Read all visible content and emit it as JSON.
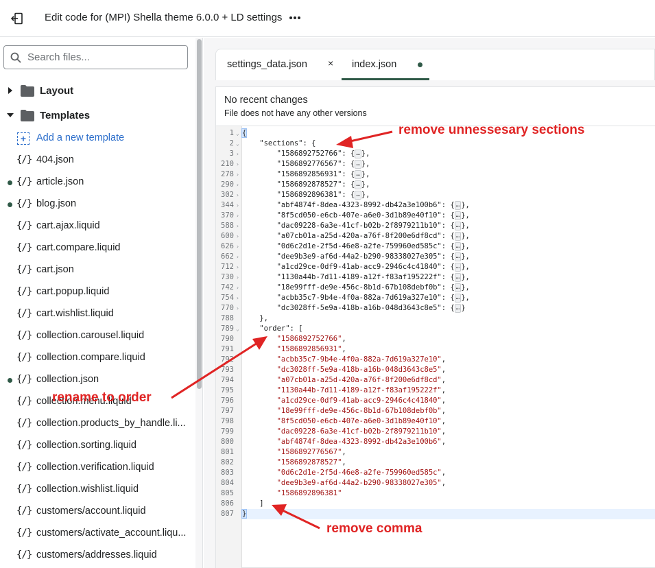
{
  "header": {
    "title": "Edit code for (MPI) Shella theme 6.0.0 + LD settings",
    "back_icon": "exit-icon",
    "more_icon": "ellipsis-icon"
  },
  "sidebar": {
    "search_placeholder": "Search files...",
    "folders": [
      {
        "label": "Layout",
        "expanded": false
      },
      {
        "label": "Templates",
        "expanded": true
      }
    ],
    "add_template_label": "Add a new template",
    "file_icon_text": "{/}",
    "files": [
      {
        "name": "404.json",
        "modified": false
      },
      {
        "name": "article.json",
        "modified": true
      },
      {
        "name": "blog.json",
        "modified": true
      },
      {
        "name": "cart.ajax.liquid",
        "modified": false
      },
      {
        "name": "cart.compare.liquid",
        "modified": false
      },
      {
        "name": "cart.json",
        "modified": false
      },
      {
        "name": "cart.popup.liquid",
        "modified": false
      },
      {
        "name": "cart.wishlist.liquid",
        "modified": false
      },
      {
        "name": "collection.carousel.liquid",
        "modified": false
      },
      {
        "name": "collection.compare.liquid",
        "modified": false
      },
      {
        "name": "collection.json",
        "modified": true
      },
      {
        "name": "collection.menu.liquid",
        "modified": false
      },
      {
        "name": "collection.products_by_handle.li...",
        "modified": false
      },
      {
        "name": "collection.sorting.liquid",
        "modified": false
      },
      {
        "name": "collection.verification.liquid",
        "modified": false
      },
      {
        "name": "collection.wishlist.liquid",
        "modified": false
      },
      {
        "name": "customers/account.liquid",
        "modified": false
      },
      {
        "name": "customers/activate_account.liqu...",
        "modified": false
      },
      {
        "name": "customers/addresses.liquid",
        "modified": false
      }
    ]
  },
  "tabs": [
    {
      "label": "settings_data.json",
      "close": "×"
    },
    {
      "label": "index.json",
      "active": true
    }
  ],
  "status": {
    "heading": "No recent changes",
    "subtext": "File does not have any other versions"
  },
  "code_lines": [
    {
      "n": "1",
      "fold": "⌄",
      "text": "{",
      "brace": true
    },
    {
      "n": "2",
      "fold": "⌄",
      "text": "    \"sections\": {"
    },
    {
      "n": "3",
      "fold": "›",
      "key": "\"1586892752766\"",
      "collapsed": "…",
      "tail": "},"
    },
    {
      "n": "210",
      "fold": "›",
      "key": "\"1586892776567\"",
      "collapsed": "…",
      "tail": "},"
    },
    {
      "n": "278",
      "fold": "›",
      "key": "\"1586892856931\"",
      "collapsed": "…",
      "tail": "},"
    },
    {
      "n": "290",
      "fold": "›",
      "key": "\"1586892878527\"",
      "collapsed": "…",
      "tail": "},"
    },
    {
      "n": "302",
      "fold": "›",
      "key": "\"1586892896381\"",
      "collapsed": "…",
      "tail": "},"
    },
    {
      "n": "344",
      "fold": "›",
      "key": "\"abf4874f-8dea-4323-8992-db42a3e100b6\"",
      "collapsed": "…",
      "tail": "},"
    },
    {
      "n": "370",
      "fold": "›",
      "key": "\"8f5cd050-e6cb-407e-a6e0-3d1b89e40f10\"",
      "collapsed": "…",
      "tail": "},"
    },
    {
      "n": "588",
      "fold": "›",
      "key": "\"dac09228-6a3e-41cf-b02b-2f8979211b10\"",
      "collapsed": "…",
      "tail": "},"
    },
    {
      "n": "600",
      "fold": "›",
      "key": "\"a07cb01a-a25d-420a-a76f-8f200e6df8cd\"",
      "collapsed": "…",
      "tail": "},"
    },
    {
      "n": "626",
      "fold": "›",
      "key": "\"0d6c2d1e-2f5d-46e8-a2fe-759960ed585c\"",
      "collapsed": "…",
      "tail": "},"
    },
    {
      "n": "662",
      "fold": "›",
      "key": "\"dee9b3e9-af6d-44a2-b290-98338027e305\"",
      "collapsed": "…",
      "tail": "},"
    },
    {
      "n": "712",
      "fold": "›",
      "key": "\"a1cd29ce-0df9-41ab-acc9-2946c4c41840\"",
      "collapsed": "…",
      "tail": "},"
    },
    {
      "n": "730",
      "fold": "›",
      "key": "\"1130a44b-7d11-4189-a12f-f83af195222f\"",
      "collapsed": "…",
      "tail": "},"
    },
    {
      "n": "742",
      "fold": "›",
      "key": "\"18e99fff-de9e-456c-8b1d-67b108debf0b\"",
      "collapsed": "…",
      "tail": "},"
    },
    {
      "n": "754",
      "fold": "›",
      "key": "\"acbb35c7-9b4e-4f0a-882a-7d619a327e10\"",
      "collapsed": "…",
      "tail": "},"
    },
    {
      "n": "770",
      "fold": "›",
      "key": "\"dc3028ff-5e9a-418b-a16b-048d3643c8e5\"",
      "collapsed": "…",
      "tail": "}"
    },
    {
      "n": "788",
      "fold": "",
      "text": "    },"
    },
    {
      "n": "789",
      "fold": "⌄",
      "text": "    \"order\": ["
    },
    {
      "n": "790",
      "fold": "",
      "value": "\"1586892752766\"",
      "tail": ","
    },
    {
      "n": "791",
      "fold": "",
      "value": "\"1586892856931\"",
      "tail": ","
    },
    {
      "n": "792",
      "fold": "",
      "value": "\"acbb35c7-9b4e-4f0a-882a-7d619a327e10\"",
      "tail": ","
    },
    {
      "n": "793",
      "fold": "",
      "value": "\"dc3028ff-5e9a-418b-a16b-048d3643c8e5\"",
      "tail": ","
    },
    {
      "n": "794",
      "fold": "",
      "value": "\"a07cb01a-a25d-420a-a76f-8f200e6df8cd\"",
      "tail": ","
    },
    {
      "n": "795",
      "fold": "",
      "value": "\"1130a44b-7d11-4189-a12f-f83af195222f\"",
      "tail": ","
    },
    {
      "n": "796",
      "fold": "",
      "value": "\"a1cd29ce-0df9-41ab-acc9-2946c4c41840\"",
      "tail": ","
    },
    {
      "n": "797",
      "fold": "",
      "value": "\"18e99fff-de9e-456c-8b1d-67b108debf0b\"",
      "tail": ","
    },
    {
      "n": "798",
      "fold": "",
      "value": "\"8f5cd050-e6cb-407e-a6e0-3d1b89e40f10\"",
      "tail": ","
    },
    {
      "n": "799",
      "fold": "",
      "value": "\"dac09228-6a3e-41cf-b02b-2f8979211b10\"",
      "tail": ","
    },
    {
      "n": "800",
      "fold": "",
      "value": "\"abf4874f-8dea-4323-8992-db42a3e100b6\"",
      "tail": ","
    },
    {
      "n": "801",
      "fold": "",
      "value": "\"1586892776567\"",
      "tail": ","
    },
    {
      "n": "802",
      "fold": "",
      "value": "\"1586892878527\"",
      "tail": ","
    },
    {
      "n": "803",
      "fold": "",
      "value": "\"0d6c2d1e-2f5d-46e8-a2fe-759960ed585c\"",
      "tail": ","
    },
    {
      "n": "804",
      "fold": "",
      "value": "\"dee9b3e9-af6d-44a2-b290-98338027e305\"",
      "tail": ","
    },
    {
      "n": "805",
      "fold": "",
      "value": "\"1586892896381\"",
      "tail": ""
    },
    {
      "n": "806",
      "fold": "",
      "text": "    ]"
    },
    {
      "n": "807",
      "fold": "",
      "text": "}",
      "brace": true,
      "active": true
    }
  ],
  "annotations": [
    {
      "text": "remove unnessesary sections"
    },
    {
      "text": "rename to order"
    },
    {
      "text": "remove comma"
    }
  ],
  "colors": {
    "accent": "#2f5947",
    "link": "#2c6ecb",
    "string": "#a31515",
    "annotation": "#e02424"
  }
}
